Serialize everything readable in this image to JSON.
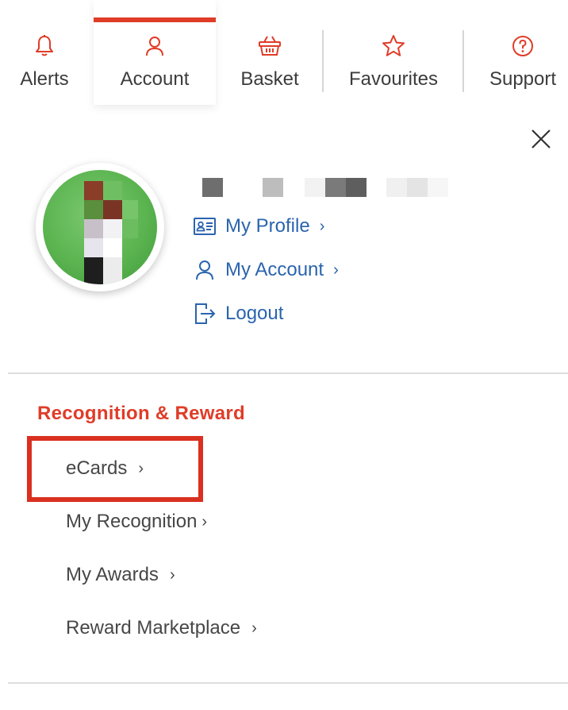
{
  "nav": {
    "items": [
      {
        "label": "Alerts",
        "icon": "bell-icon"
      },
      {
        "label": "Account",
        "icon": "user-icon",
        "active": true
      },
      {
        "label": "Basket",
        "icon": "basket-icon"
      },
      {
        "label": "Favourites",
        "icon": "star-icon"
      },
      {
        "label": "Support",
        "icon": "help-icon"
      }
    ]
  },
  "profile": {
    "links": [
      {
        "label": "My Profile",
        "icon": "id-card-icon",
        "chevron": "›"
      },
      {
        "label": "My Account",
        "icon": "user-icon",
        "chevron": "›"
      },
      {
        "label": "Logout",
        "icon": "logout-icon"
      }
    ]
  },
  "recognition": {
    "title": "Recognition & Reward",
    "items": [
      {
        "label": "eCards",
        "chevron": "›",
        "highlighted": true
      },
      {
        "label": "My Recognition",
        "chevron": "›"
      },
      {
        "label": "My Awards",
        "chevron": "›"
      },
      {
        "label": "Reward Marketplace",
        "chevron": "›"
      }
    ]
  },
  "colors": {
    "accent": "#e03c28",
    "link": "#2a64ae",
    "highlight_border": "#d93020"
  }
}
